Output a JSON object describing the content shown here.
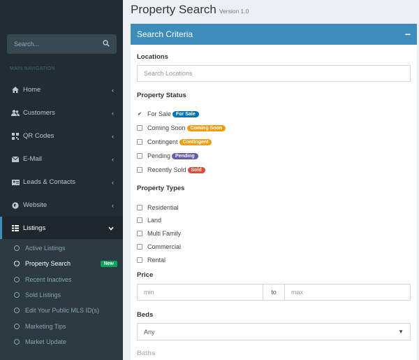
{
  "sidebar": {
    "search_placeholder": "Search...",
    "nav_header": "MAIN NAVIGATION",
    "items": [
      {
        "label": "Home",
        "icon": "home-icon"
      },
      {
        "label": "Customers",
        "icon": "users-icon"
      },
      {
        "label": "QR Codes",
        "icon": "qrcode-icon"
      },
      {
        "label": "E-Mail",
        "icon": "envelope-icon"
      },
      {
        "label": "Leads & Contacts",
        "icon": "address-card-icon"
      },
      {
        "label": "Website",
        "icon": "globe-icon"
      },
      {
        "label": "Listings",
        "icon": "list-icon"
      }
    ],
    "subitems": [
      {
        "label": "Active Listings"
      },
      {
        "label": "Property Search",
        "badge": "New"
      },
      {
        "label": "Recent Inactives"
      },
      {
        "label": "Sold Listings"
      },
      {
        "label": "Edit Your Public MLS ID(s)"
      },
      {
        "label": "Marketing Tips"
      },
      {
        "label": "Market Update"
      }
    ]
  },
  "page": {
    "title": "Property Search",
    "version": "Version 1.0"
  },
  "panel": {
    "title": "Search Criteria",
    "collapse_label": "−",
    "locations_label": "Locations",
    "locations_placeholder": "Search Locations",
    "status_label": "Property Status",
    "statuses": [
      {
        "label": "For Sale",
        "tag": "For Sale",
        "color": "#0073b7",
        "checked": true
      },
      {
        "label": "Coming Soon",
        "tag": "Coming Soon",
        "color": "#f39c12",
        "checked": false
      },
      {
        "label": "Contingent",
        "tag": "Contingent",
        "color": "#f39c12",
        "checked": false
      },
      {
        "label": "Pending",
        "tag": "Pending",
        "color": "#605ca8",
        "checked": false
      },
      {
        "label": "Recently Sold",
        "tag": "Sold",
        "color": "#dd4b39",
        "checked": false
      }
    ],
    "types_label": "Property Types",
    "types": [
      "Residential",
      "Land",
      "Multi Family",
      "Commercial",
      "Rental"
    ],
    "price_label": "Price",
    "price_min_placeholder": "min",
    "price_to": "to",
    "price_max_placeholder": "max",
    "beds_label": "Beds",
    "beds_value": "Any",
    "baths_label": "Baths"
  },
  "colors": {
    "accent": "#3c8dbc",
    "sidebar": "#222d32",
    "badge_new": "#00a65a"
  }
}
